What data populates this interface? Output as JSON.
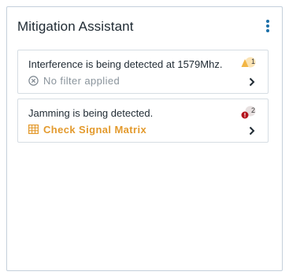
{
  "panel": {
    "title": "Mitigation Assistant",
    "menu_icon": "more-vertical-icon"
  },
  "alerts": [
    {
      "message": "Interference is being detected at 1579Mhz.",
      "detail": "No filter applied",
      "detail_icon": "cancel-circle-icon",
      "severity": "warning",
      "severity_icon": "warning-triangle-icon",
      "count": "1",
      "action_icon": "chevron-right-icon"
    },
    {
      "message": "Jamming is being detected.",
      "detail": "Check Signal Matrix",
      "detail_icon": "grid-table-icon",
      "severity": "critical",
      "severity_icon": "critical-alert-icon",
      "count": "2",
      "action_icon": "chevron-right-icon"
    }
  ],
  "colors": {
    "accent": "#1b6fa8",
    "link": "#e39a2d",
    "warning": "#f2b544",
    "critical": "#b3121b"
  }
}
